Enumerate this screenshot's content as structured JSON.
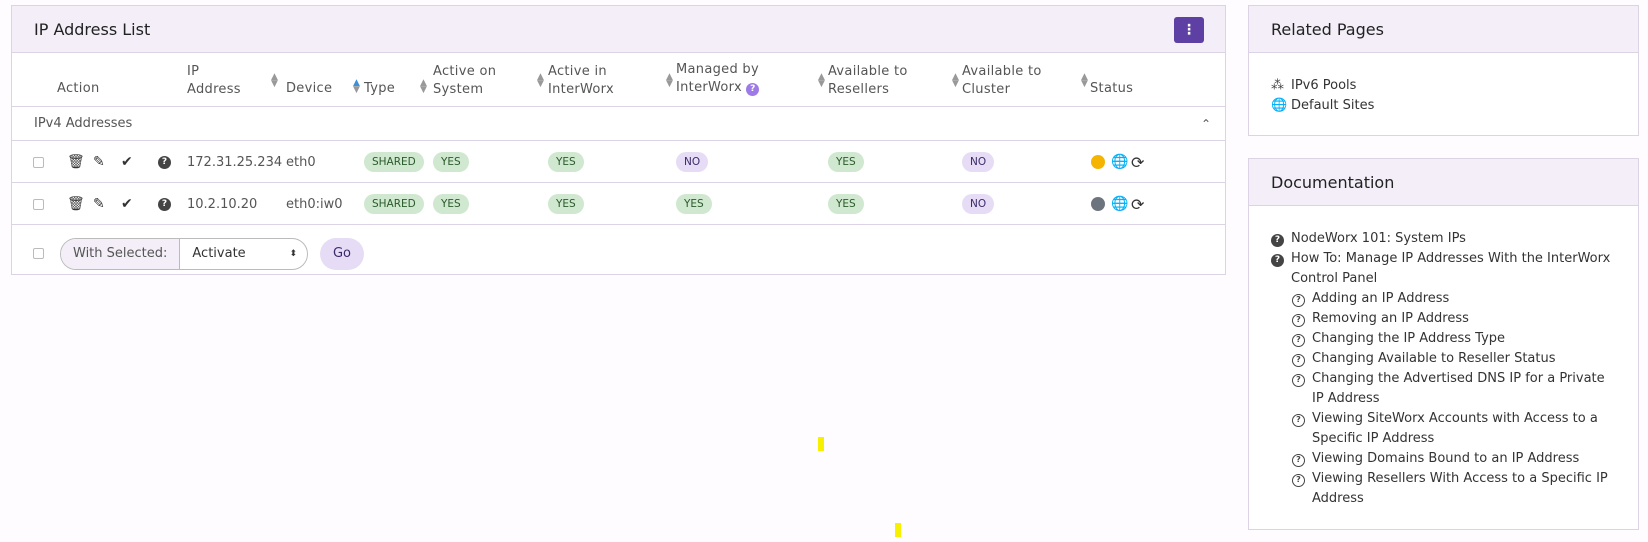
{
  "main": {
    "title": "IP Address List",
    "columns": {
      "action": "Action",
      "ip_line1": "IP",
      "ip_line2": "Address",
      "device": "Device",
      "type": "Type",
      "active_sys_1": "Active on",
      "active_sys_2": "System",
      "active_iw_1": "Active in",
      "active_iw_2": "InterWorx",
      "managed_1": "Managed by",
      "managed_2": "InterWorx",
      "resellers_1": "Available to",
      "resellers_2": "Resellers",
      "cluster_1": "Available to",
      "cluster_2": "Cluster",
      "status": "Status"
    },
    "group_label": "IPv4 Addresses",
    "rows": [
      {
        "ip": "172.31.25.234",
        "device": "eth0",
        "type": "SHARED",
        "active_sys": "YES",
        "active_iw": "YES",
        "managed": "NO",
        "resellers": "YES",
        "cluster": "NO",
        "status_color": "#f5b400"
      },
      {
        "ip": "10.2.10.20",
        "device": "eth0:iw0",
        "type": "SHARED",
        "active_sys": "YES",
        "active_iw": "YES",
        "managed": "YES",
        "resellers": "YES",
        "cluster": "NO",
        "status_color": "#6c757d"
      }
    ],
    "footer": {
      "with_selected": "With Selected:",
      "selected_action": "Activate",
      "go": "Go"
    }
  },
  "related": {
    "title": "Related Pages",
    "items": [
      "IPv6 Pools",
      "Default Sites"
    ]
  },
  "docs": {
    "title": "Documentation",
    "items": [
      {
        "text": "NodeWorx 101: System IPs",
        "sub": false
      },
      {
        "text": "How To: Manage IP Addresses With the InterWorx Control Panel",
        "sub": false
      },
      {
        "text": "Adding an IP Address",
        "sub": true
      },
      {
        "text": "Removing an IP Address",
        "sub": true
      },
      {
        "text": "Changing the IP Address Type",
        "sub": true
      },
      {
        "text": "Changing Available to Reseller Status",
        "sub": true
      },
      {
        "text": "Changing the Advertised DNS IP for a Private IP Address",
        "sub": true
      },
      {
        "text": "Viewing SiteWorx Accounts with Access to a Specific IP Address",
        "sub": true
      },
      {
        "text": "Viewing Domains Bound to an IP Address",
        "sub": true
      },
      {
        "text": "Viewing Resellers With Access to a Specific IP Address",
        "sub": true
      }
    ]
  }
}
